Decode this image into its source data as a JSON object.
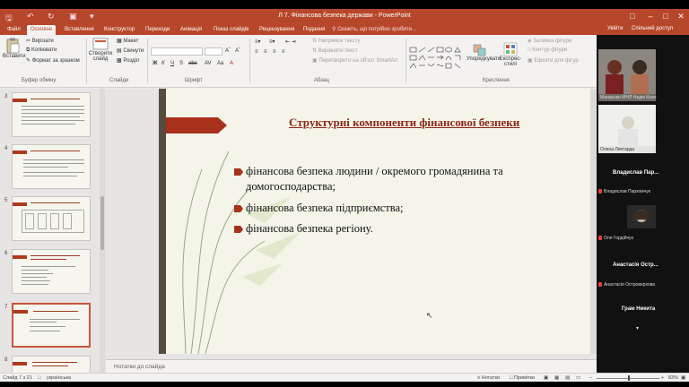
{
  "titlebar": {
    "title": "Л 7. Фінансова безпека держави - PowerPoint"
  },
  "tabs": [
    "Файл",
    "Основне",
    "Вставлення",
    "Конструктор",
    "Переходи",
    "Анімація",
    "Показ слайдів",
    "Рецензування",
    "Подання"
  ],
  "active_tab": "Основне",
  "tell_me": "Скажіть, що потрібно зробити...",
  "account": {
    "signin": "Увійти",
    "share": "Спільний доступ"
  },
  "ribbon": {
    "paste": "Вставити",
    "cut": "Вирізати",
    "copy": "Копіювати",
    "format_painter": "Формат за зразком",
    "clipboard_group": "Буфер обміну",
    "new_slide": "Створити слайд",
    "layout": "Макет",
    "reset": "Скинути",
    "section": "Розділ",
    "slides_group": "Слайди",
    "font_group": "Шрифт",
    "text_direction": "Напрямок тексту",
    "align_text": "Вирівняти текст",
    "smartart": "Перетворити на об'єкт SmartArt",
    "paragraph_group": "Абзац",
    "arrange": "Упорядкувати",
    "quick_styles": "Експрес-стилі",
    "shape_fill": "Заливка фігури",
    "shape_outline": "Контур фігури",
    "shape_effects": "Ефекти для фігур",
    "drawing_group": "Креслення"
  },
  "video": {
    "tile1_name": "Манаєнко МНЛ Надія Кнап",
    "tile2_name": "Олена Липгарда",
    "p1_big": "Владислав Пар...",
    "p1_small": "Владислав Пархомчук",
    "p2_small": "Оля Гордійчук",
    "p3_big": "Анастасія Остр...",
    "p3_small": "Анастасія Островерхова",
    "p4_big": "Грам Никита"
  },
  "thumbnails": [
    {
      "num": "3"
    },
    {
      "num": "4"
    },
    {
      "num": "5"
    },
    {
      "num": "6"
    },
    {
      "num": "7"
    },
    {
      "num": "8"
    }
  ],
  "selected_slide": "7",
  "slide": {
    "title": "Структурні компоненти фінансової безпеки",
    "bullets": [
      "фінансова безпека людини / окремого громадянина та домогосподарства;",
      "фінансова безпека підприємства;",
      "фінансова безпека регіону."
    ]
  },
  "notes_placeholder": "Нотатки до слайда",
  "status": {
    "slide_of": "Слайд 7 з 21",
    "language": "українська",
    "notes": "Нотатки",
    "comments": "Примітки",
    "zoom": "83%"
  },
  "colors": {
    "accent": "#b7472a",
    "slide_title": "#8a2617",
    "slide_bg": "#f4f4e9"
  }
}
